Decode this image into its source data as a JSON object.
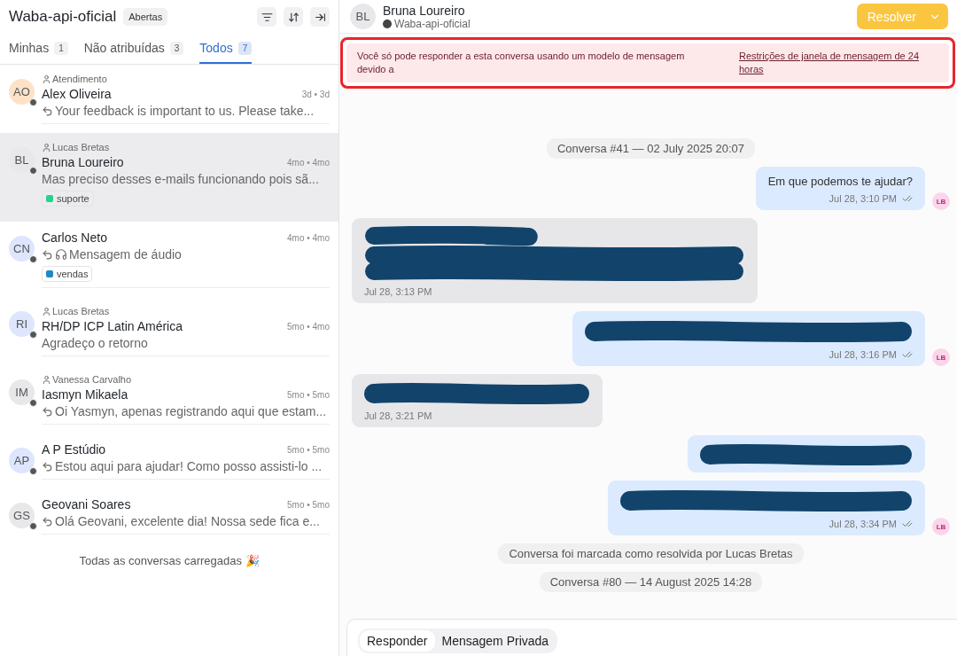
{
  "inbox": {
    "title": "Waba-api-oficial",
    "status_badge": "Abertas"
  },
  "tabs": [
    {
      "label": "Minhas",
      "count": "1",
      "selected": false
    },
    {
      "label": "Não atribuídas",
      "count": "3",
      "selected": false
    },
    {
      "label": "Todos",
      "count": "7",
      "selected": true
    }
  ],
  "conversations": [
    {
      "initials": "AO",
      "color": "#fde2c8",
      "assignee": "Atendimento",
      "name": "Alex Oliveira",
      "time": "3d • 3d",
      "preview": "Your feedback is important to us. Please take...",
      "replied": true,
      "audio": false,
      "selected": false
    },
    {
      "initials": "BL",
      "color": "#e8e8ea",
      "assignee": "Lucas Bretas",
      "name": "Bruna Loureiro",
      "time": "4mo • 4mo",
      "preview": "Mas preciso desses e-mails funcionando pois sã...",
      "replied": false,
      "audio": false,
      "selected": true,
      "tag": {
        "label": "suporte",
        "color": "#22d38a"
      }
    },
    {
      "initials": "CN",
      "color": "#dde6fd",
      "name": "Carlos Neto",
      "time": "4mo • 4mo",
      "preview": "Mensagem de áudio",
      "replied": true,
      "audio": true,
      "selected": false,
      "tag": {
        "label": "vendas",
        "color": "#1e88c8"
      }
    },
    {
      "initials": "RI",
      "color": "#dde6fd",
      "assignee": "Lucas Bretas",
      "name": "RH/DP ICP Latin América",
      "time": "5mo • 4mo",
      "preview": "Agradeço o retorno",
      "replied": false,
      "audio": false,
      "selected": false
    },
    {
      "initials": "IM",
      "color": "#e8e8ea",
      "assignee": "Vanessa Carvalho",
      "name": "Iasmyn Mikaela",
      "time": "5mo • 5mo",
      "preview": "Oi Yasmyn, apenas registrando aqui que estam...",
      "replied": true,
      "audio": false,
      "selected": false
    },
    {
      "initials": "AP",
      "color": "#dde6fd",
      "name": "A P Estúdio",
      "time": "5mo • 5mo",
      "preview": "Estou aqui para ajudar! Como posso assisti-lo ...",
      "replied": true,
      "audio": false,
      "selected": false
    },
    {
      "initials": "GS",
      "color": "#e8e8ea",
      "name": "Geovani Soares",
      "time": "5mo • 5mo",
      "preview": "Olá Geovani, excelente dia! Nossa sede fica e...",
      "replied": true,
      "audio": false,
      "selected": false
    }
  ],
  "list_footer": "Todas as conversas carregadas 🎉",
  "chat_header": {
    "initials": "BL",
    "name": "Bruna Loureiro",
    "channel": "Waba-api-oficial",
    "resolve_button": "Resolver"
  },
  "banner": {
    "text": "Você só pode responder a esta conversa usando um modelo de mensagem devido a",
    "link": "Restrições de janela de mensagem de 24 horas"
  },
  "messages": [
    {
      "kind": "divider",
      "text": "Conversa #41 — 02 July 2025 20:07"
    },
    {
      "kind": "outgoing",
      "text": "Em que podemos te ajudar?",
      "time": "Jul 28, 3:10 PM",
      "avatar": "LB"
    },
    {
      "kind": "incoming-redacted",
      "time": "Jul 28, 3:13 PM"
    },
    {
      "kind": "outgoing-redacted",
      "time": "Jul 28, 3:16 PM",
      "avatar": "LB"
    },
    {
      "kind": "incoming-redacted",
      "time": "Jul 28, 3:21 PM"
    },
    {
      "kind": "outgoing-redacted"
    },
    {
      "kind": "outgoing-redacted",
      "time": "Jul 28, 3:34 PM",
      "avatar": "LB"
    },
    {
      "kind": "divider",
      "text": "Conversa foi marcada como resolvida por Lucas Bretas"
    },
    {
      "kind": "divider",
      "text": "Conversa #80 — 14 August 2025 14:28"
    }
  ],
  "composer": {
    "modes": [
      {
        "label": "Responder",
        "selected": true
      },
      {
        "label": "Mensagem Privada",
        "selected": false
      }
    ]
  }
}
